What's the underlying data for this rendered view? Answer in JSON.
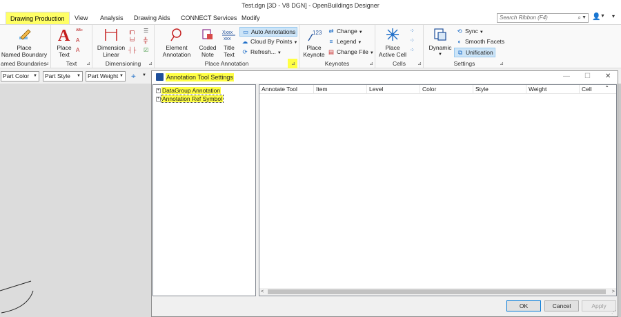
{
  "window": {
    "title": "Test.dgn [3D - V8 DGN] - OpenBuildings Designer"
  },
  "ribbon_tabs": [
    {
      "label": "Drawing Production",
      "active": true
    },
    {
      "label": "View"
    },
    {
      "label": "Analysis"
    },
    {
      "label": "Drawing Aids"
    },
    {
      "label": "CONNECT Services"
    },
    {
      "label": "Modify"
    }
  ],
  "search": {
    "placeholder": "Search Ribbon (F4)"
  },
  "ribbon": {
    "named_boundaries": {
      "label": "amed Boundaries",
      "place_label_1": "Place",
      "place_label_2": "Named Boundary"
    },
    "text": {
      "label": "Text",
      "place_text_1": "Place",
      "place_text_2": "Text"
    },
    "dimensioning": {
      "label": "Dimensioning",
      "dim_1": "Dimension",
      "dim_2": "Linear"
    },
    "place_annotation": {
      "label": "Place Annotation",
      "element_1": "Element",
      "element_2": "Annotation",
      "coded_1": "Coded",
      "coded_2": "Note",
      "title_1": "Title",
      "title_2": "Text",
      "auto_annotations": "Auto Annotations",
      "cloud_by_points": "Cloud By Points",
      "refresh": "Refresh..."
    },
    "keynotes": {
      "label": "Keynotes",
      "place_1": "Place",
      "place_2": "Keynote",
      "change": "Change",
      "legend": "Legend",
      "change_file": "Change File"
    },
    "cells": {
      "label": "Cells",
      "place_1": "Place",
      "place_2": "Active Cell"
    },
    "settings": {
      "label": "Settings",
      "dynamic": "Dynamic",
      "sync": "Sync",
      "smooth_facets": "Smooth Facets",
      "unification": "Unification"
    }
  },
  "toolbar2": {
    "part_color": "Part Color",
    "part_style": "Part Style",
    "part_weight": "Part Weight"
  },
  "dialog": {
    "title": "Annotation Tool Settings",
    "tree": [
      {
        "label": "DataGroup Annotation"
      },
      {
        "label": "Annotation Ref Symbol"
      }
    ],
    "columns": [
      "Annotate Tool",
      "Item",
      "Level",
      "Color",
      "Style",
      "Weight",
      "Cell"
    ],
    "ok": "OK",
    "cancel": "Cancel",
    "apply": "Apply"
  },
  "colors": {
    "highlight": "#ffff44",
    "accent": "#1e6ec8"
  }
}
